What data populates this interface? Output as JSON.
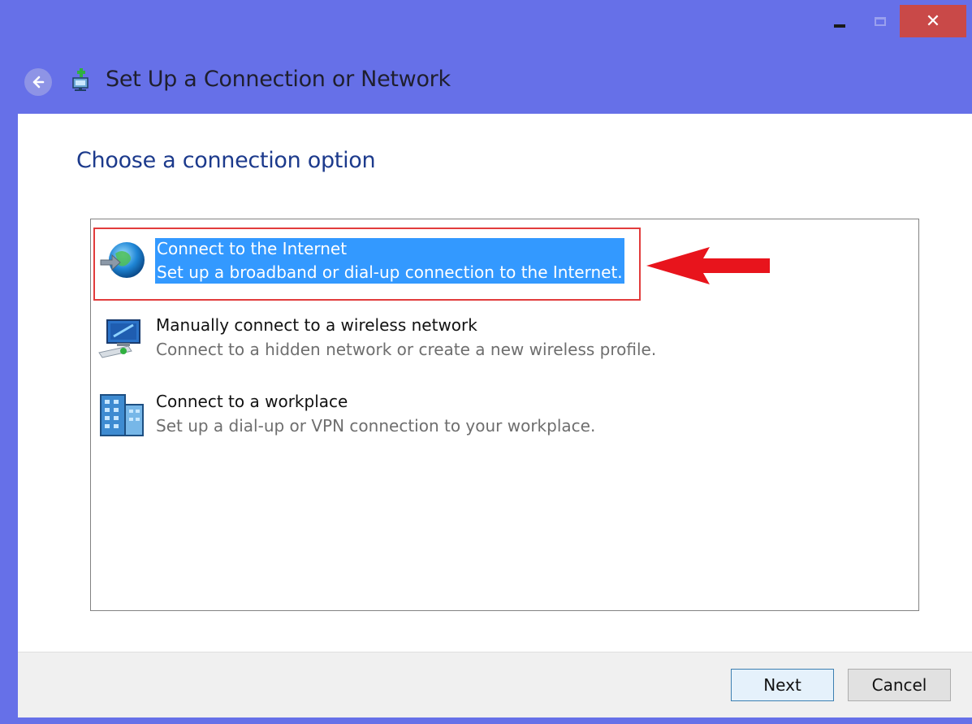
{
  "window": {
    "title": "Set Up a Connection or Network",
    "controls": {
      "minimize": "minimize",
      "maximize": "maximize",
      "close": "✕"
    }
  },
  "main": {
    "heading": "Choose a connection option",
    "options": [
      {
        "title": "Connect to the Internet",
        "description": "Set up a broadband or dial-up connection to the Internet.",
        "icon": "globe-connect-icon",
        "selected": true
      },
      {
        "title": "Manually connect to a wireless network",
        "description": "Connect to a hidden network or create a new wireless profile.",
        "icon": "wireless-network-icon",
        "selected": false
      },
      {
        "title": "Connect to a workplace",
        "description": "Set up a dial-up or VPN connection to your workplace.",
        "icon": "workplace-building-icon",
        "selected": false
      }
    ]
  },
  "footer": {
    "next_label": "Next",
    "cancel_label": "Cancel"
  },
  "colors": {
    "titlebar": "#6670e8",
    "selection": "#3399ff",
    "highlight_frame": "#e23c3c",
    "heading": "#1c3a8c",
    "close": "#c94948"
  }
}
